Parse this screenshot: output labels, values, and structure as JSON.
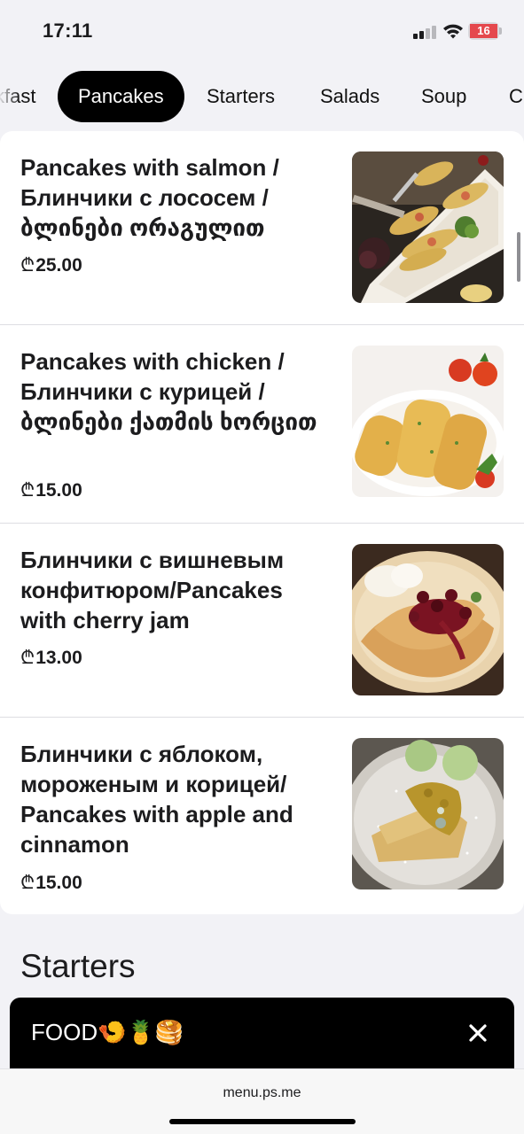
{
  "status_bar": {
    "time": "17:11",
    "battery_level": "16",
    "battery_color": "#e5484d",
    "icons": [
      "cellular-signal-icon",
      "wifi-icon",
      "battery-icon"
    ]
  },
  "tabs": [
    {
      "label": "kfast",
      "active": false
    },
    {
      "label": "Pancakes",
      "active": true
    },
    {
      "label": "Starters",
      "active": false
    },
    {
      "label": "Salads",
      "active": false
    },
    {
      "label": "Soup",
      "active": false
    },
    {
      "label": "C",
      "active": false
    }
  ],
  "menu": {
    "currency_symbol": "₾",
    "items": [
      {
        "title": "Pancakes with salmon / Блинчики с лососем / ბლინები ორაგულით",
        "price": "25.00",
        "photo": "pancakes-with-salmon-photo"
      },
      {
        "title": "Pancakes with chicken / Блинчики с курицей / ბლინები ქათმის ხორცით",
        "price": "15.00",
        "photo": "pancakes-with-chicken-photo"
      },
      {
        "title": "Блинчики с вишневым конфитюром/Pancakes with cherry jam",
        "price": "13.00",
        "photo": "pancakes-with-cherry-jam-photo"
      },
      {
        "title": "Блинчики с яблоком, мороженым и корицей/ Pancakes with apple and cinnamon",
        "price": "15.00",
        "photo": "pancakes-with-apple-photo"
      }
    ]
  },
  "next_section": {
    "title": "Starters"
  },
  "order_bar": {
    "label": "FOOD🍤🍍🥞",
    "close_icon": "close-icon"
  },
  "browser": {
    "url": "menu.ps.me"
  }
}
